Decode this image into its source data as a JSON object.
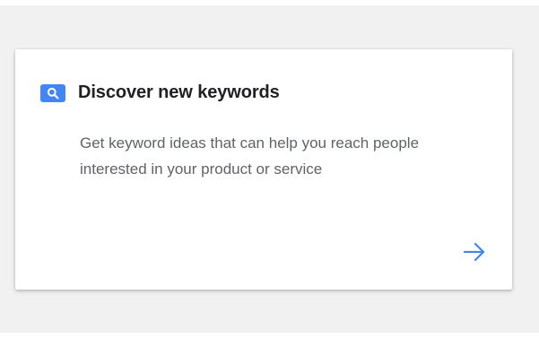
{
  "card": {
    "title": "Discover new keywords",
    "description": "Get keyword ideas that can help you reach people interested in your product or service",
    "icon": "search-icon",
    "action_icon": "arrow-right-icon"
  },
  "colors": {
    "accent": "#4285f4",
    "title": "#202124",
    "body_text": "#5f6368",
    "background": "#f1f1f1",
    "card": "#ffffff"
  }
}
